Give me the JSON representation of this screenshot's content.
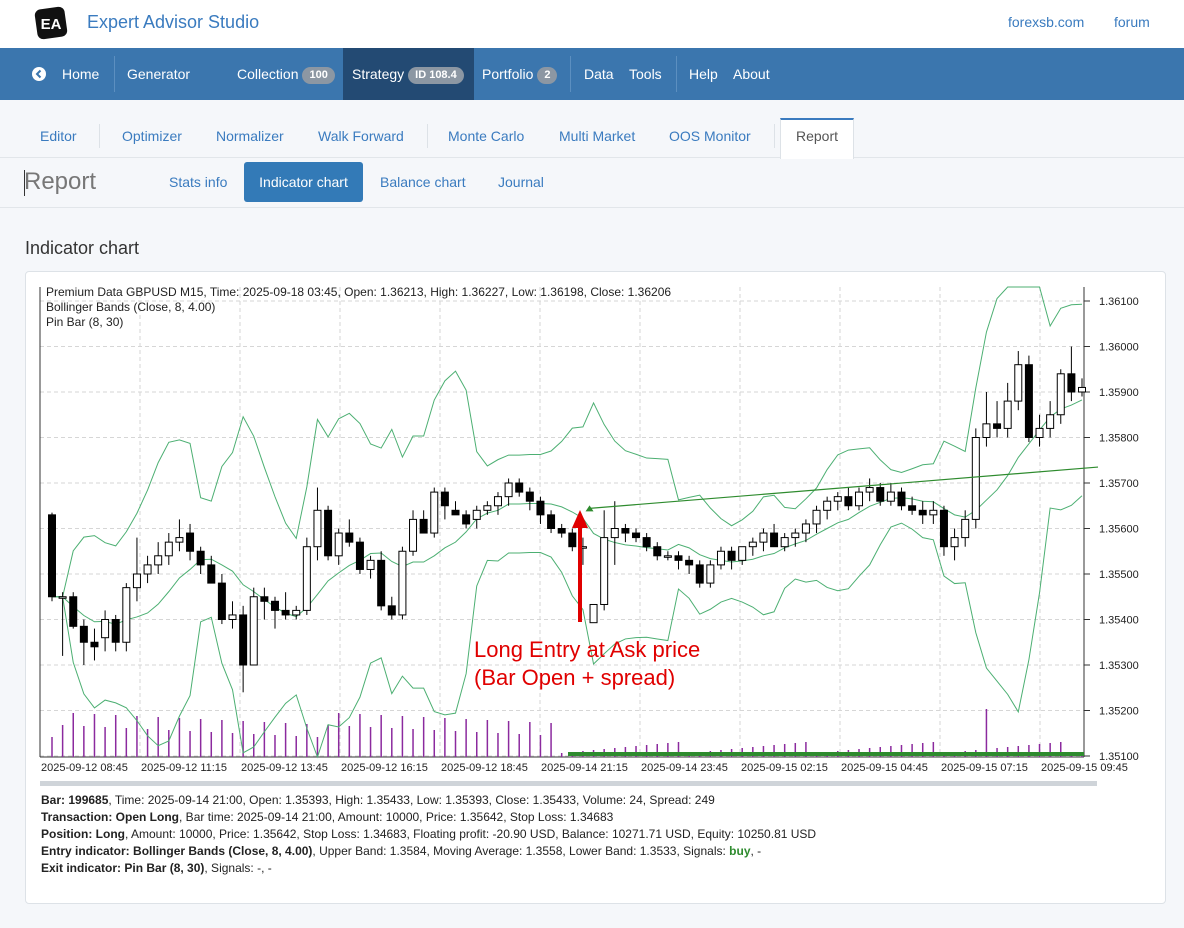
{
  "app": {
    "title": "Expert Advisor Studio",
    "logo_text": "EA",
    "links": [
      "forexsb.com",
      "forum"
    ]
  },
  "nav": {
    "home": "Home",
    "generator": "Generator",
    "collection": "Collection",
    "collection_count": "100",
    "strategy": "Strategy",
    "strategy_badge": "ID 108.4",
    "portfolio": "Portfolio",
    "portfolio_count": "2",
    "data": "Data",
    "tools": "Tools",
    "help": "Help",
    "about": "About"
  },
  "subtabs": [
    "Editor",
    "Optimizer",
    "Normalizer",
    "Walk Forward",
    "Monte Carlo",
    "Multi Market",
    "OOS Monitor",
    "Report"
  ],
  "report": {
    "title": "Report",
    "tabs": [
      "Stats info",
      "Indicator chart",
      "Balance chart",
      "Journal"
    ],
    "active_tab": "Indicator chart"
  },
  "section_title": "Indicator chart",
  "chart_header": [
    "Premium Data GBPUSD M15, Time: 2025-09-18 03:45, Open: 1.36213, High: 1.36227, Low: 1.36198, Close: 1.36206",
    "Bollinger Bands (Close, 8, 4.00)",
    "Pin Bar (8, 30)"
  ],
  "annotation": {
    "line1": "Long Entry at Ask price",
    "line2": "(Bar Open + spread)"
  },
  "colors": {
    "nav": "#3b76ae",
    "nav_active": "#234a73",
    "accent": "#337ab7",
    "bands": "#4caf72",
    "annotation": "#e00000",
    "volume": "#8b2a9e"
  },
  "chart_data": {
    "type": "candlestick",
    "y_ticks": [
      "1.36100",
      "1.36000",
      "1.35900",
      "1.35800",
      "1.35700",
      "1.35600",
      "1.35500",
      "1.35400",
      "1.35300",
      "1.35200",
      "1.35100"
    ],
    "ylim": [
      1.351,
      1.3613
    ],
    "x_ticks": [
      "2025-09-12 08:45",
      "2025-09-12 11:15",
      "2025-09-12 13:45",
      "2025-09-12 16:15",
      "2025-09-12 18:45",
      "2025-09-14 21:15",
      "2025-09-14 23:45",
      "2025-09-15 02:15",
      "2025-09-15 04:45",
      "2025-09-15 07:15",
      "2025-09-15 09:45"
    ],
    "series": [
      "Bollinger Bands upper",
      "Bollinger Bands middle",
      "Bollinger Bands lower"
    ],
    "entry_price": 1.35642
  },
  "details": {
    "bar_label": "Bar: 199685",
    "bar": ", Time: 2025-09-14 21:00, Open: 1.35393, High: 1.35433, Low: 1.35393, Close: 1.35433, Volume: 24, Spread: 249",
    "tx_label": "Transaction: Open Long",
    "tx": ", Bar time: 2025-09-14 21:00, Amount: 10000, Price: 1.35642, Stop Loss: 1.34683",
    "pos_label": "Position: Long",
    "pos": ", Amount: 10000, Price: 1.35642, Stop Loss: 1.34683, Floating profit: -20.90 USD, Balance: 10271.71 USD, Equity: 10250.81 USD",
    "entry_label": "Entry indicator:",
    "entry_name": "Bollinger Bands (Close, 8, 4.00)",
    "entry_rest": ", Upper Band: 1.3584, Moving Average: 1.3558, Lower Band: 1.3533, Signals: ",
    "entry_signal": "buy",
    "entry_tail": ", -",
    "exit_label": "Exit indicator:",
    "exit_name": "Pin Bar (8, 30)",
    "exit_rest": ", Signals: -, -"
  }
}
